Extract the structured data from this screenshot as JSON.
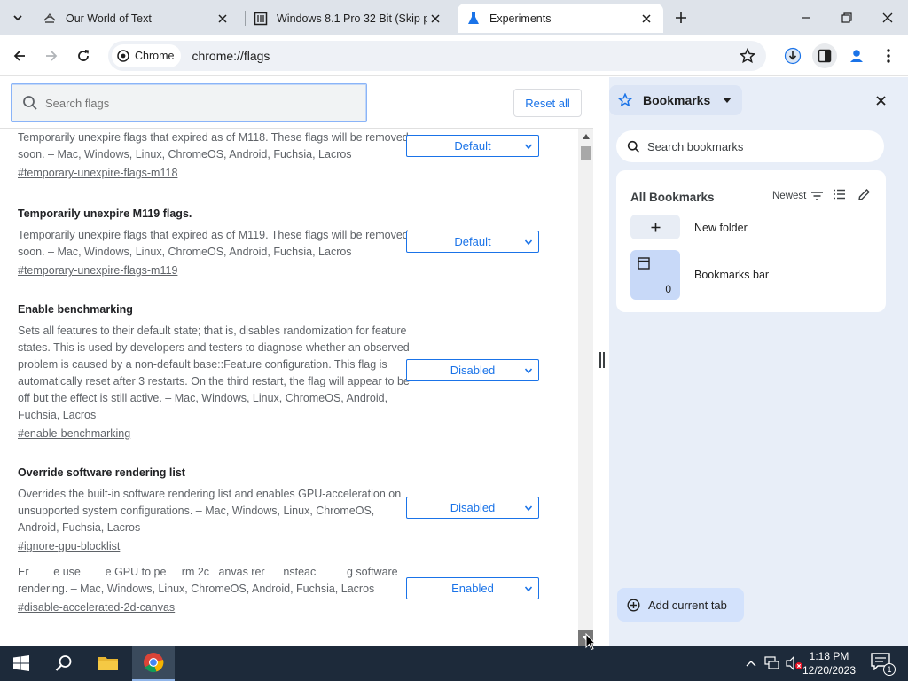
{
  "tabs": [
    {
      "title": "Our World of Text",
      "active": false
    },
    {
      "title": "Windows 8.1 Pro 32 Bit (Skip p",
      "active": false
    },
    {
      "title": "Experiments",
      "active": true
    }
  ],
  "toolbar": {
    "chip_label": "Chrome",
    "url": "chrome://flags"
  },
  "flags_page": {
    "search_placeholder": "Search flags",
    "reset_label": "Reset all",
    "items": [
      {
        "title": "",
        "description": "Temporarily unexpire flags that expired as of M118. These flags will be removed soon. – Mac, Windows, Linux, ChromeOS, Android, Fuchsia, Lacros",
        "link": "#temporary-unexpire-flags-m118",
        "value": "Default"
      },
      {
        "title": "Temporarily unexpire M119 flags.",
        "description": "Temporarily unexpire flags that expired as of M119. These flags will be removed soon. – Mac, Windows, Linux, ChromeOS, Android, Fuchsia, Lacros",
        "link": "#temporary-unexpire-flags-m119",
        "value": "Default"
      },
      {
        "title": "Enable benchmarking",
        "description": "Sets all features to their default state; that is, disables randomization for feature states. This is used by developers and testers to diagnose whether an observed problem is caused by a non-default base::Feature configuration. This flag is automatically reset after 3 restarts. On the third restart, the flag will appear to be off but the effect is still active. – Mac, Windows, Linux, ChromeOS, Android, Fuchsia, Lacros",
        "link": "#enable-benchmarking",
        "value": "Disabled"
      },
      {
        "title": "Override software rendering list",
        "description": "Overrides the built-in software rendering list and enables GPU-acceleration on unsupported system configurations. – Mac, Windows, Linux, ChromeOS, Android, Fuchsia, Lacros",
        "link": "#ignore-gpu-blocklist",
        "value": "Disabled"
      },
      {
        "title": "",
        "description": "Er        e use        e GPU to pe     rm 2c   anvas rer      nsteac          g software rendering. – Mac, Windows, Linux, ChromeOS, Android, Fuchsia, Lacros",
        "link": "#disable-accelerated-2d-canvas",
        "value": "Enabled"
      }
    ]
  },
  "side_panel": {
    "title": "Bookmarks",
    "search_placeholder": "Search bookmarks",
    "all_bookmarks": "All Bookmarks",
    "sort_label": "Newest",
    "new_folder": "New folder",
    "bookmarks_bar": "Bookmarks bar",
    "bookmarks_bar_count": "0",
    "add_current_tab": "Add current tab"
  },
  "taskbar": {
    "time": "1:18 PM",
    "date": "12/20/2023",
    "notification_count": "1"
  },
  "colors": {
    "accent": "#1a73e8",
    "tabstrip": "#dee3ea",
    "side_panel": "#e8eef8",
    "taskbar": "#1d2a3a"
  }
}
